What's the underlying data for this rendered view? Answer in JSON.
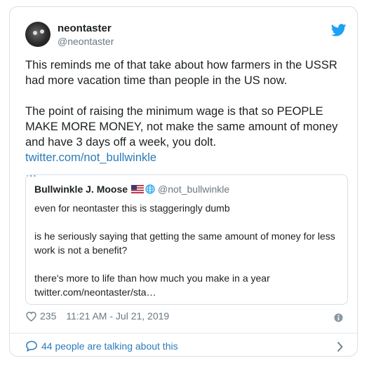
{
  "tweet": {
    "author_name": "neontaster",
    "author_handle": "@neontaster",
    "paragraph_1": "This reminds me of that take about how farmers in the USSR had more vacation time than people in the US now.",
    "paragraph_2_text": "The point of raising the minimum wage is that so PEOPLE MAKE MORE MONEY, not make the same amount of money and have 3 days off a week, you dolt.",
    "paragraph_2_link": "twitter.com/not_bullwinkle",
    "ellipsis": "…"
  },
  "quoted": {
    "author_name": "Bullwinkle J. Moose",
    "author_handle": "@not_bullwinkle",
    "line_1": "even for neontaster this is staggeringly dumb",
    "line_2": "is he seriously saying that getting the same amount of money for less work is not a benefit?",
    "line_3": "there's more to life than how much you make in a year",
    "line_4": "twitter.com/neontaster/sta…"
  },
  "meta": {
    "likes": "235",
    "timestamp": "11:21 AM - Jul 21, 2019"
  },
  "footer": {
    "talking_label": "44 people are talking about this"
  },
  "icons": {
    "bird": "twitter-bird-icon",
    "heart": "heart-icon",
    "info": "info-icon",
    "bubble": "comment-bubble-icon",
    "chevron": "chevron-right-icon",
    "flag": "us-flag-icon",
    "globe": "globe-icon"
  },
  "colors": {
    "link": "#2b7bb9",
    "twitter_blue": "#1da1f2",
    "secondary_text": "#697882",
    "border": "#d8dfe5"
  }
}
